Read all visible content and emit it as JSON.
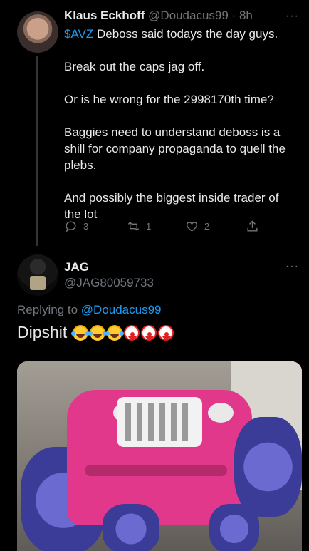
{
  "tweet1": {
    "name": "Klaus Eckhoff",
    "handle": "@Doudacus99",
    "separator": "·",
    "time": "8h",
    "more": "···",
    "cashtag": "$AVZ",
    "line1_rest": " Deboss said todays the day guys.",
    "para2": "Break out the caps jag off.",
    "para3": "Or is he wrong for the 2998170th time?",
    "para4": "Baggies need to understand deboss is a shill for company propaganda to quell the plebs.",
    "para5": "And possibly the biggest inside trader of the lot",
    "actions": {
      "reply_count": "3",
      "retweet_count": "1",
      "like_count": "2"
    },
    "icons": [
      "reply-icon",
      "retweet-icon",
      "like-icon",
      "share-icon"
    ]
  },
  "tweet2": {
    "name": "JAG",
    "handle": "@JAG80059733",
    "more": "···",
    "replying_prefix": "Replying to ",
    "replying_handle": "@Doudacus99",
    "text": "Dipshit",
    "emojis": [
      "laughing-emoji",
      "laughing-emoji",
      "laughing-emoji",
      "clown-emoji",
      "clown-emoji",
      "clown-emoji"
    ]
  },
  "colors": {
    "background": "#000000",
    "text": "#e7e9ea",
    "secondary": "#71767b",
    "link": "#1d9bf0"
  }
}
